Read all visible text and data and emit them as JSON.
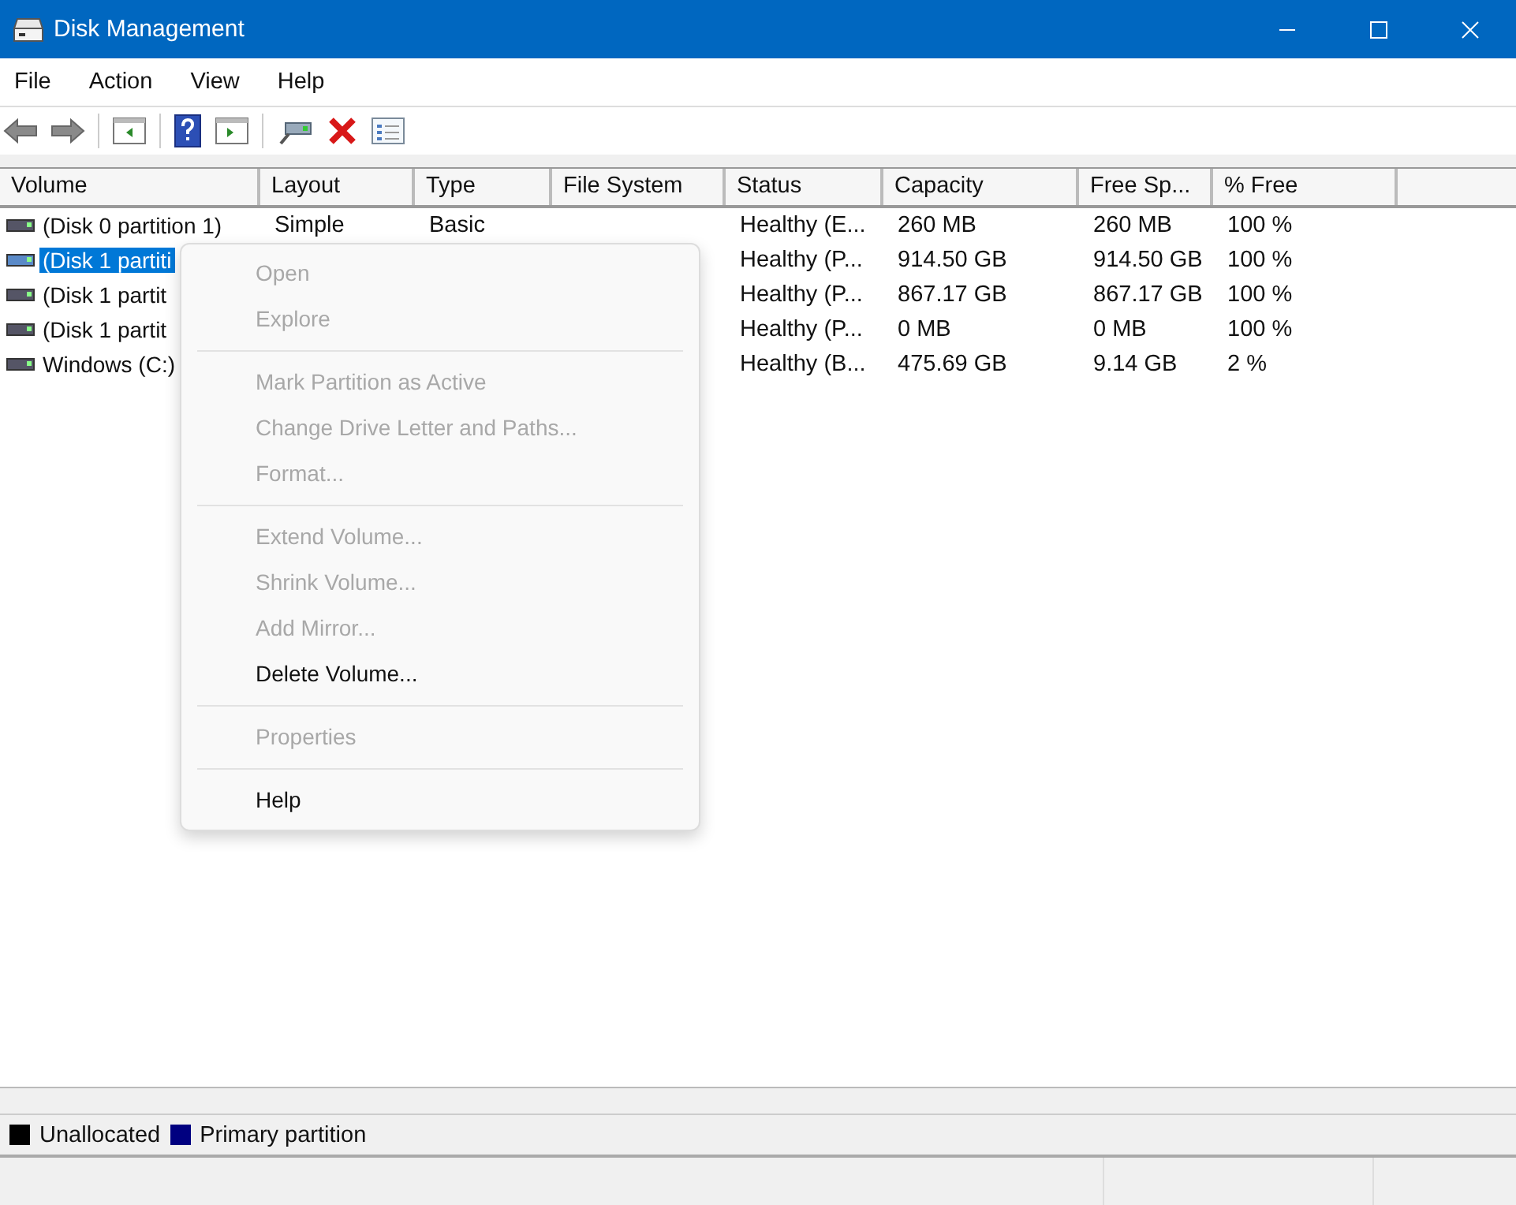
{
  "window": {
    "title": "Disk Management"
  },
  "menu_bar": [
    "File",
    "Action",
    "View",
    "Help"
  ],
  "table": {
    "columns": [
      "Volume",
      "Layout",
      "Type",
      "File System",
      "Status",
      "Capacity",
      "Free Sp...",
      "% Free"
    ],
    "rows": [
      {
        "selected": false,
        "cells": [
          "(Disk 0 partition 1)",
          "Simple",
          "Basic",
          "",
          "Healthy (E...",
          "260 MB",
          "260 MB",
          "100 %"
        ]
      },
      {
        "selected": true,
        "cells": [
          "(Disk 1 partiti",
          "",
          "",
          "",
          "Healthy (P...",
          "914.50 GB",
          "914.50 GB",
          "100 %"
        ]
      },
      {
        "selected": false,
        "cells": [
          "(Disk 1 partit",
          "",
          "",
          "",
          "Healthy (P...",
          "867.17 GB",
          "867.17 GB",
          "100 %"
        ]
      },
      {
        "selected": false,
        "cells": [
          "(Disk 1 partit",
          "",
          "",
          "",
          "Healthy (P...",
          "0 MB",
          "0 MB",
          "100 %"
        ]
      },
      {
        "selected": false,
        "cells": [
          "Windows (C:)",
          "",
          "",
          "",
          "Healthy (B...",
          "475.69 GB",
          "9.14 GB",
          "2 %"
        ]
      }
    ]
  },
  "context_menu": [
    {
      "kind": "item",
      "label": "Open",
      "disabled": true
    },
    {
      "kind": "item",
      "label": "Explore",
      "disabled": true
    },
    {
      "kind": "separator"
    },
    {
      "kind": "item",
      "label": "Mark Partition as Active",
      "disabled": true
    },
    {
      "kind": "item",
      "label": "Change Drive Letter and Paths...",
      "disabled": true
    },
    {
      "kind": "item",
      "label": "Format...",
      "disabled": true
    },
    {
      "kind": "separator"
    },
    {
      "kind": "item",
      "label": "Extend Volume...",
      "disabled": true
    },
    {
      "kind": "item",
      "label": "Shrink Volume...",
      "disabled": true
    },
    {
      "kind": "item",
      "label": "Add Mirror...",
      "disabled": true
    },
    {
      "kind": "item",
      "label": "Delete Volume...",
      "disabled": false
    },
    {
      "kind": "separator"
    },
    {
      "kind": "item",
      "label": "Properties",
      "disabled": true
    },
    {
      "kind": "separator"
    },
    {
      "kind": "item",
      "label": "Help",
      "disabled": false
    }
  ],
  "legend": [
    {
      "label": "Unallocated",
      "color": "#000000"
    },
    {
      "label": "Primary partition",
      "color": "#000080"
    }
  ]
}
